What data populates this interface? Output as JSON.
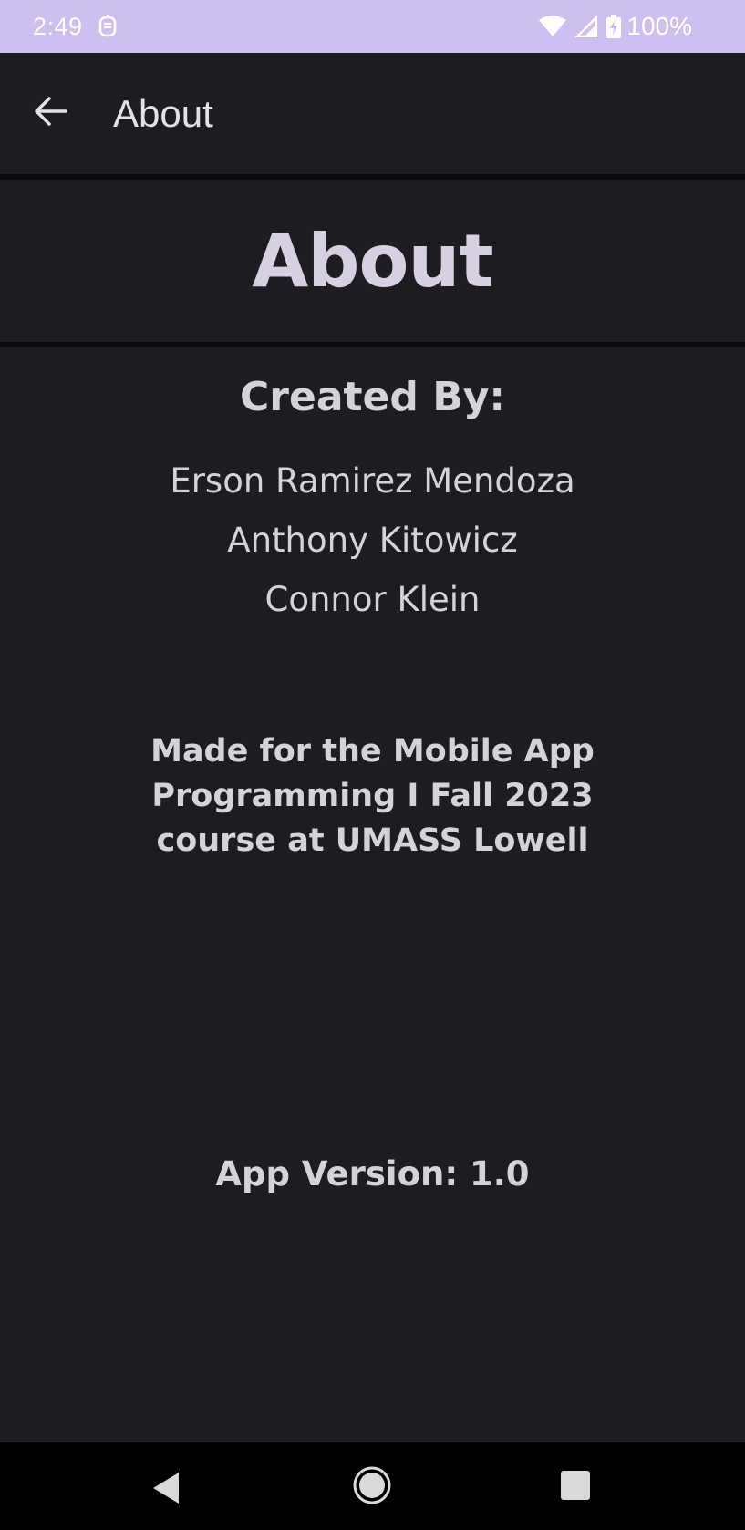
{
  "status_bar": {
    "time": "2:49",
    "battery": "100%",
    "icons": [
      "app-notification-icon",
      "wifi-icon",
      "cell-signal-icon",
      "battery-charging-icon"
    ],
    "background": "#cdbfef"
  },
  "app_bar": {
    "title": "About",
    "back_icon": "arrow-back-icon"
  },
  "page": {
    "heading": "About",
    "created_by_label": "Created By:",
    "members": [
      "Erson Ramirez Mendoza",
      "Anthony Kitowicz",
      "Connor Klein"
    ],
    "course_note": "Made for the Mobile App Programming I Fall 2023 course at UMASS Lowell",
    "app_version": "App Version: 1.0"
  },
  "nav_bar": {
    "buttons": [
      "nav-back-icon",
      "nav-home-icon",
      "nav-recents-icon"
    ]
  },
  "colors": {
    "background": "#1d1c21",
    "text": "#d6d2da",
    "heading": "#d7cfe2",
    "divider": "#0a0a0c"
  }
}
